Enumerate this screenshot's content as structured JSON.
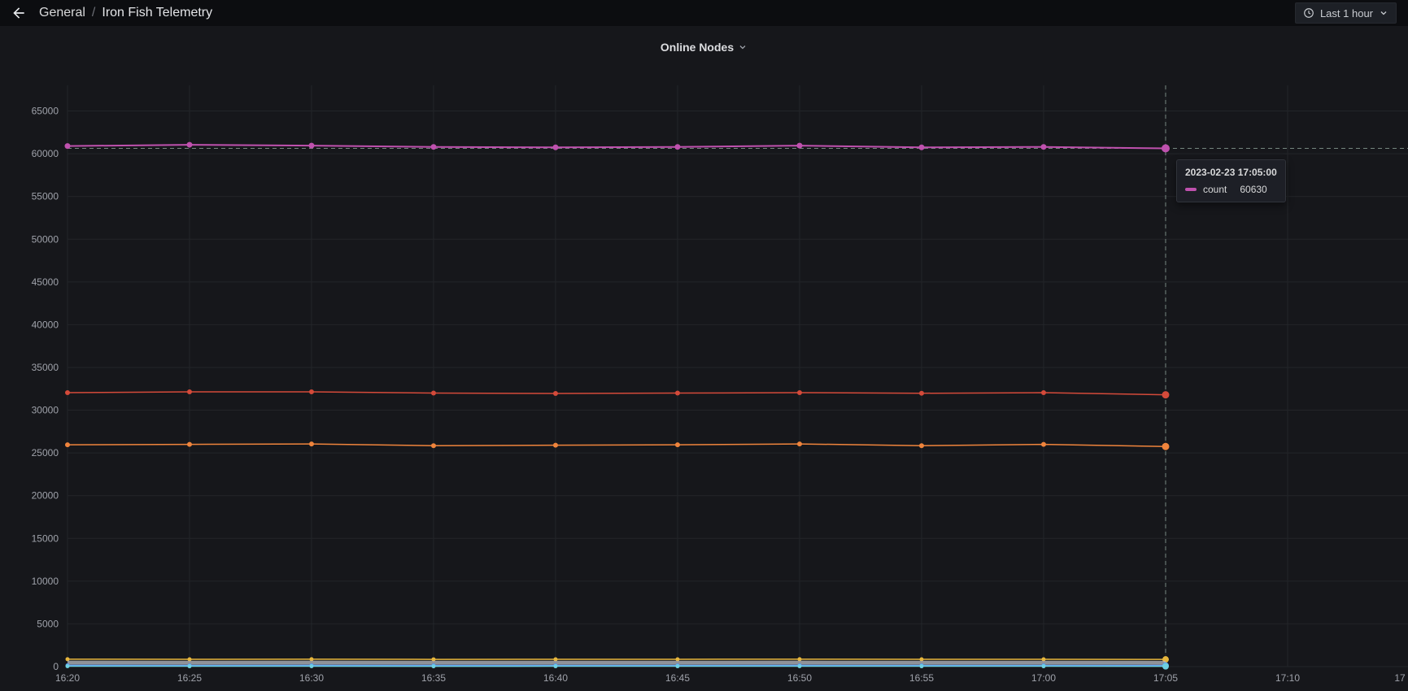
{
  "nav": {
    "breadcrumb": {
      "section": "General",
      "separator": "/",
      "title": "Iron Fish Telemetry"
    },
    "time_picker": {
      "label": "Last 1 hour"
    }
  },
  "panel": {
    "title": "Online Nodes"
  },
  "tooltip": {
    "timestamp": "2023-02-23 17:05:00",
    "series_label": "count",
    "value": "60630",
    "swatch_color": "#bf51ae"
  },
  "chart_data": {
    "type": "line",
    "title": "Online Nodes",
    "x_axis": {
      "ticks": [
        {
          "label": "16:20",
          "min": 0
        },
        {
          "label": "16:25",
          "min": 5
        },
        {
          "label": "16:30",
          "min": 10
        },
        {
          "label": "16:35",
          "min": 15
        },
        {
          "label": "16:40",
          "min": 20
        },
        {
          "label": "16:45",
          "min": 25
        },
        {
          "label": "16:50",
          "min": 30
        },
        {
          "label": "16:55",
          "min": 35
        },
        {
          "label": "17:00",
          "min": 40
        },
        {
          "label": "17:05",
          "min": 45
        },
        {
          "label": "17:10",
          "min": 50
        },
        {
          "label": "17",
          "min": 55
        }
      ]
    },
    "y_axis": {
      "min": 0,
      "max": 68000,
      "ticks": [
        0,
        5000,
        10000,
        15000,
        20000,
        25000,
        30000,
        35000,
        40000,
        45000,
        50000,
        55000,
        60000,
        65000
      ]
    },
    "x_points_min": [
      0,
      5,
      10,
      15,
      20,
      25,
      30,
      35,
      40,
      45
    ],
    "series": [
      {
        "name": "series-red",
        "color": "#d44a3a",
        "width": 1.5,
        "opacity": 1,
        "point_radius": 3,
        "values": [
          32050,
          32150,
          32150,
          32000,
          31950,
          32000,
          32050,
          31980,
          32050,
          31800
        ]
      },
      {
        "name": "series-orange",
        "color": "#ef843c",
        "width": 1.5,
        "opacity": 1,
        "point_radius": 3,
        "values": [
          25950,
          26000,
          26050,
          25850,
          25900,
          25950,
          26050,
          25850,
          26000,
          25750
        ]
      },
      {
        "name": "series-yellow",
        "color": "#e7b63c",
        "width": 1.5,
        "opacity": 1,
        "point_radius": 2.5,
        "values": [
          870,
          860,
          865,
          850,
          855,
          860,
          870,
          855,
          860,
          840
        ]
      },
      {
        "name": "series-gray",
        "color": "#b8bcc4",
        "width": 5,
        "opacity": 0.75,
        "point_radius": 0,
        "values": [
          460,
          455,
          458,
          450,
          452,
          455,
          458,
          452,
          455,
          445
        ]
      },
      {
        "name": "series-blue",
        "color": "#5794f2",
        "width": 1.5,
        "opacity": 1,
        "point_radius": 2.5,
        "values": [
          140,
          135,
          138,
          130,
          132,
          135,
          138,
          132,
          135,
          125
        ]
      },
      {
        "name": "series-cyan",
        "color": "#6ed0e0",
        "width": 1.5,
        "opacity": 1,
        "point_radius": 2.5,
        "values": [
          45,
          42,
          44,
          40,
          42,
          43,
          44,
          42,
          43,
          35
        ]
      },
      {
        "name": "count",
        "color": "#bf51ae",
        "width": 2,
        "opacity": 1,
        "point_radius": 3.5,
        "values": [
          60900,
          61050,
          60950,
          60800,
          60750,
          60800,
          60950,
          60750,
          60800,
          60630
        ]
      }
    ],
    "crosshair": {
      "x_min": 45,
      "y_value": 60630
    },
    "legend_position": "none",
    "grid": true,
    "colors": {
      "grid": "#232529",
      "axis_text": "#9fa2aa",
      "crosshair": "#9cb6aa",
      "background": "#16171b",
      "navbar": "#0c0d10"
    }
  }
}
